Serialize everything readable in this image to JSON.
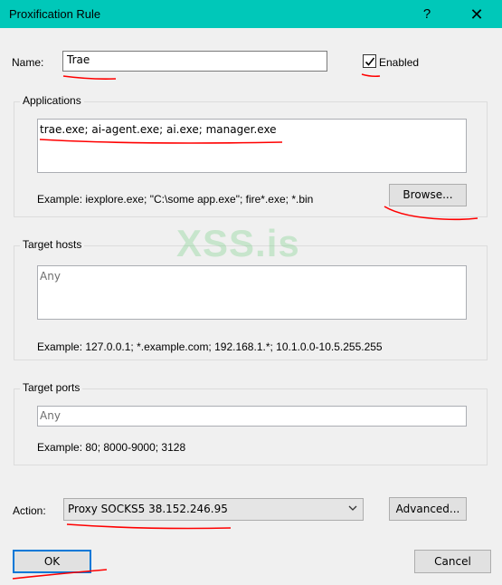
{
  "window": {
    "title": "Proxification Rule",
    "help_glyph": "?",
    "close_glyph": "✕"
  },
  "name": {
    "label": "Name:",
    "value": "Trae"
  },
  "enabled": {
    "label": "Enabled",
    "checked": true
  },
  "applications": {
    "legend": "Applications",
    "value": "trae.exe; ai-agent.exe; ai.exe; manager.exe",
    "example": "Example: iexplore.exe; \"C:\\some app.exe\"; fire*.exe; *.bin",
    "browse_label": "Browse..."
  },
  "target_hosts": {
    "legend": "Target hosts",
    "value": "Any",
    "example": "Example: 127.0.0.1; *.example.com; 192.168.1.*; 10.1.0.0-10.5.255.255"
  },
  "target_ports": {
    "legend": "Target ports",
    "value": "Any",
    "example": "Example: 80; 8000-9000; 3128"
  },
  "action": {
    "label": "Action:",
    "selected": "Proxy SOCKS5 38.152.246.95",
    "advanced_label": "Advanced..."
  },
  "buttons": {
    "ok": "OK",
    "cancel": "Cancel"
  },
  "watermark": "XSS.is",
  "colors": {
    "titlebar": "#00c8b9",
    "annotation": "#ff0000",
    "watermark": "#7dd18b"
  }
}
